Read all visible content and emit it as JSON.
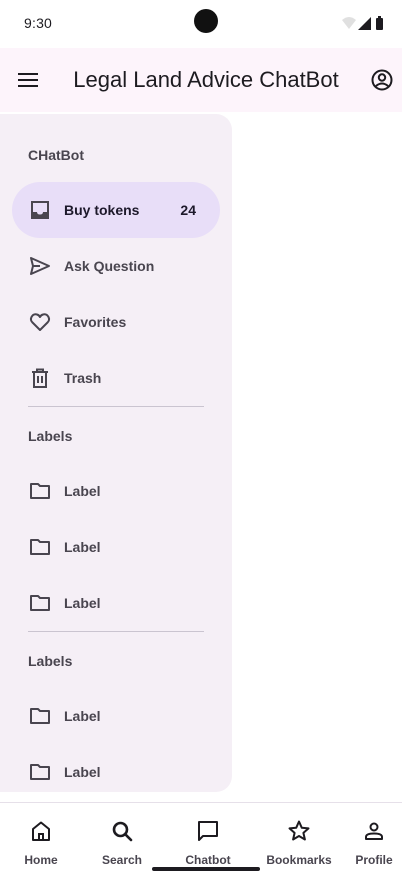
{
  "status_bar": {
    "time": "9:30"
  },
  "app_bar": {
    "title": "Legal Land Advice ChatBot"
  },
  "drawer": {
    "headline": "CHatBot",
    "items": [
      {
        "label": "Buy tokens",
        "badge": "24",
        "icon": "inbox-icon",
        "active": true
      },
      {
        "label": "Ask Question",
        "icon": "send-icon"
      },
      {
        "label": "Favorites",
        "icon": "heart-icon"
      },
      {
        "label": "Trash",
        "icon": "trash-icon"
      }
    ],
    "section1": {
      "headline": "Labels",
      "items": [
        {
          "label": "Label"
        },
        {
          "label": "Label"
        },
        {
          "label": "Label"
        }
      ]
    },
    "section2": {
      "headline": "Labels",
      "items": [
        {
          "label": "Label"
        },
        {
          "label": "Label"
        }
      ]
    }
  },
  "nav_bar": {
    "tabs": [
      {
        "label": "Home",
        "icon": "home-icon"
      },
      {
        "label": "Search",
        "icon": "search-icon"
      },
      {
        "label": "Chatbot",
        "icon": "chat-icon"
      },
      {
        "label": "Bookmarks",
        "icon": "star-icon"
      },
      {
        "label": "Profile",
        "icon": "person-icon"
      }
    ]
  },
  "colors": {
    "app_bar_bg": "#fdf4fb",
    "drawer_bg": "#f5eff6",
    "active_item_bg": "#e8def8"
  }
}
